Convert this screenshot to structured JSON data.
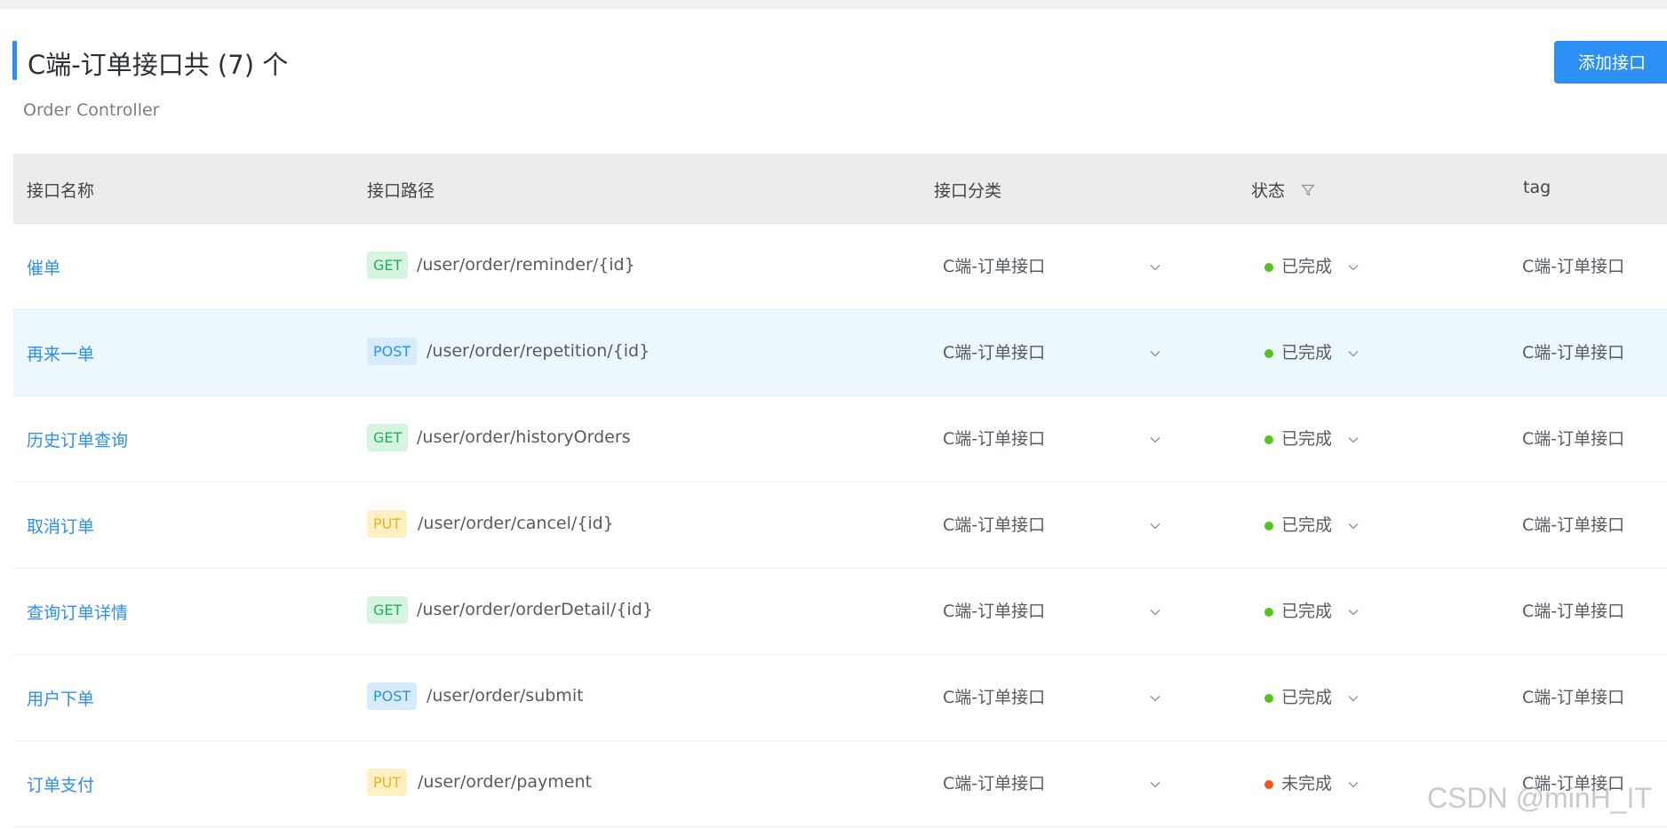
{
  "page": {
    "title": "C端-订单接口共 (7) 个",
    "subtitle": "Order Controller",
    "add_button": "添加接口"
  },
  "table": {
    "headers": {
      "name": "接口名称",
      "path": "接口路径",
      "category": "接口分类",
      "status": "状态",
      "tag": "tag"
    },
    "rows": [
      {
        "name": "催单",
        "method": "GET",
        "path": "/user/order/reminder/{id}",
        "category": "C端-订单接口",
        "status": "已完成",
        "status_color": "#52c41a",
        "tag": "C端-订单接口"
      },
      {
        "name": "再来一单",
        "method": "POST",
        "path": "/user/order/repetition/{id}",
        "category": "C端-订单接口",
        "status": "已完成",
        "status_color": "#52c41a",
        "tag": "C端-订单接口"
      },
      {
        "name": "历史订单查询",
        "method": "GET",
        "path": "/user/order/historyOrders",
        "category": "C端-订单接口",
        "status": "已完成",
        "status_color": "#52c41a",
        "tag": "C端-订单接口"
      },
      {
        "name": "取消订单",
        "method": "PUT",
        "path": "/user/order/cancel/{id}",
        "category": "C端-订单接口",
        "status": "已完成",
        "status_color": "#52c41a",
        "tag": "C端-订单接口"
      },
      {
        "name": "查询订单详情",
        "method": "GET",
        "path": "/user/order/orderDetail/{id}",
        "category": "C端-订单接口",
        "status": "已完成",
        "status_color": "#52c41a",
        "tag": "C端-订单接口"
      },
      {
        "name": "用户下单",
        "method": "POST",
        "path": "/user/order/submit",
        "category": "C端-订单接口",
        "status": "已完成",
        "status_color": "#52c41a",
        "tag": "C端-订单接口"
      },
      {
        "name": "订单支付",
        "method": "PUT",
        "path": "/user/order/payment",
        "category": "C端-订单接口",
        "status": "未完成",
        "status_color": "#fa541c",
        "tag": "C端-订单接口"
      }
    ]
  },
  "colors": {
    "accent": "#2c8ff3",
    "get": "#1fae5c",
    "post": "#2c8ff3",
    "put": "#f2b01e"
  },
  "watermark": "CSDN @minH_IT"
}
